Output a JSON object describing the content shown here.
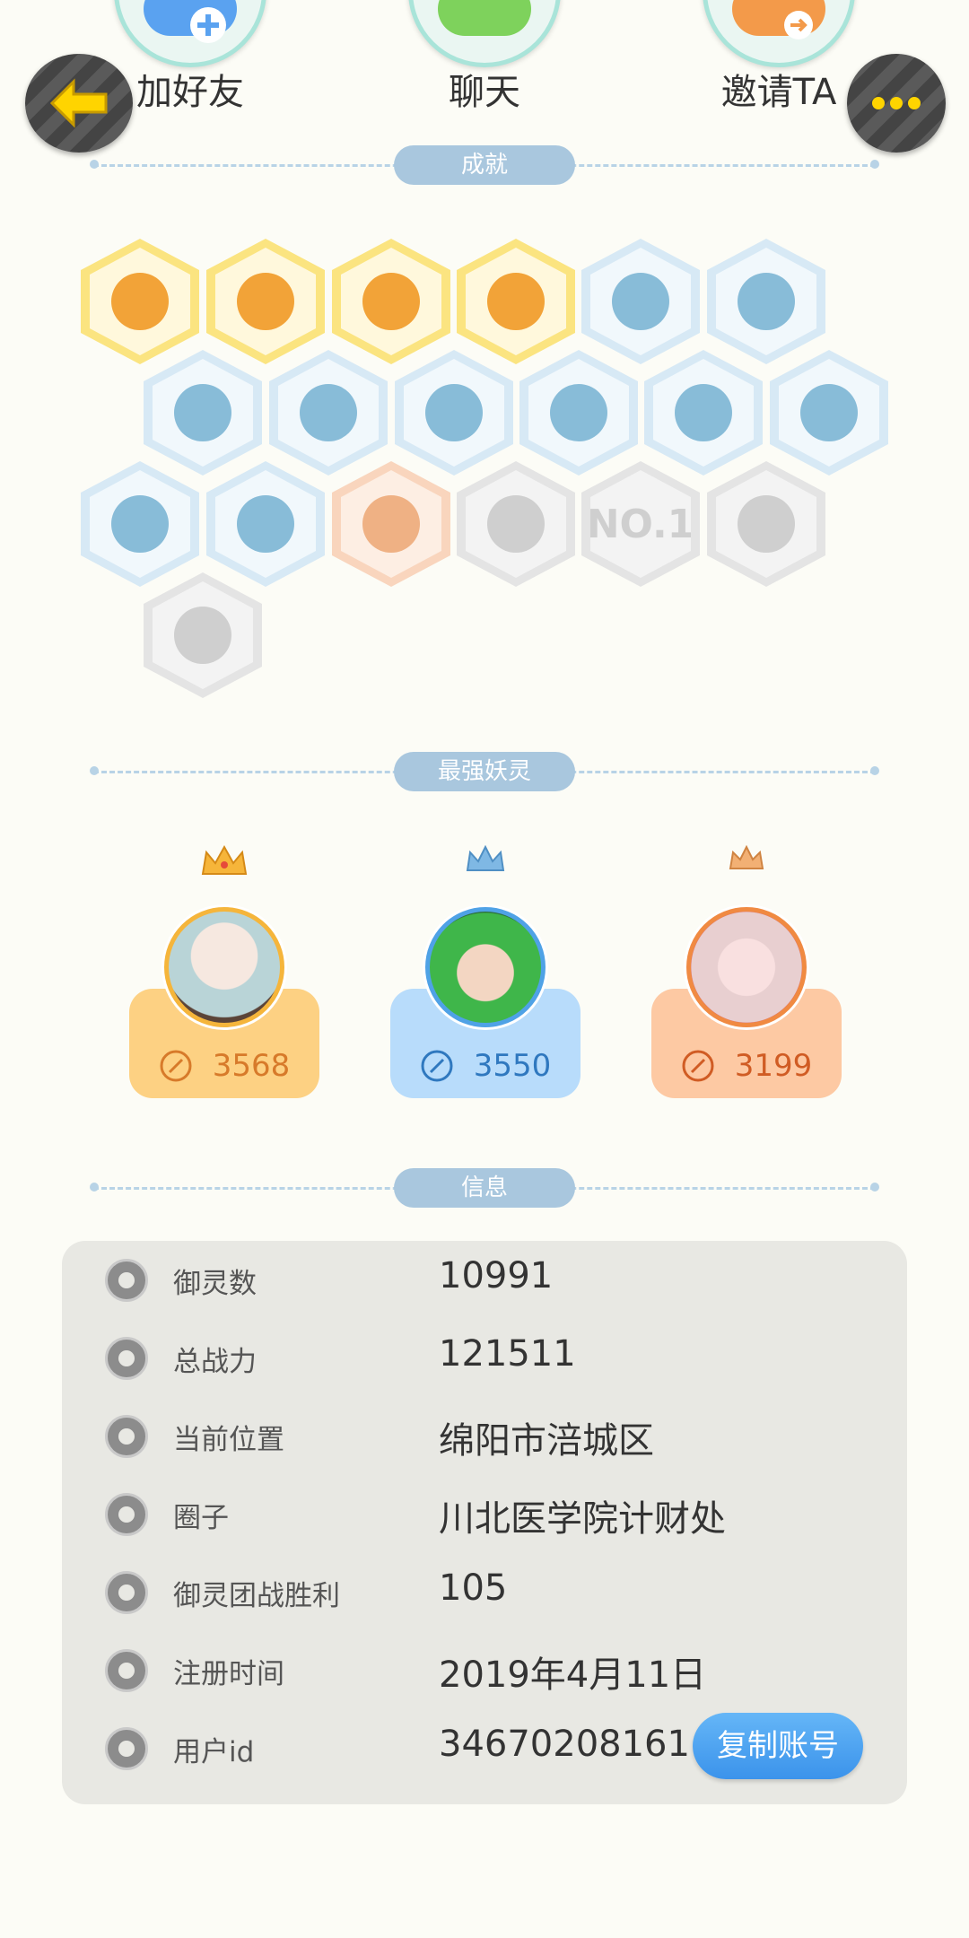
{
  "actions": {
    "add_friend": "加好友",
    "chat": "聊天",
    "invite": "邀请TA"
  },
  "sections": {
    "achievements": "成就",
    "strongest": "最强妖灵",
    "info": "信息"
  },
  "achievements": {
    "row1": [
      {
        "tier": "gold",
        "icon": "fox-face-badge"
      },
      {
        "tier": "gold",
        "icon": "moon-sun-badge"
      },
      {
        "tier": "gold",
        "icon": "orb-badge"
      },
      {
        "tier": "gold",
        "icon": "yinyang-box-badge"
      },
      {
        "tier": "blue",
        "icon": "sneaker-badge"
      },
      {
        "tier": "blue",
        "icon": "portal-badge"
      }
    ],
    "row2": [
      {
        "tier": "blue",
        "icon": "crystal-badge"
      },
      {
        "tier": "blue",
        "icon": "taiji-wave-badge"
      },
      {
        "tier": "blue",
        "icon": "sprite-statue-badge"
      },
      {
        "tier": "blue",
        "icon": "cat-cart-badge"
      },
      {
        "tier": "blue",
        "icon": "cat-lollipop-badge"
      },
      {
        "tier": "blue",
        "icon": "fish-badge"
      }
    ],
    "row3": [
      {
        "tier": "blue",
        "icon": "shield-badge"
      },
      {
        "tier": "blue",
        "icon": "horned-monster-badge"
      },
      {
        "tier": "peach",
        "icon": "sprite-pair-badge"
      },
      {
        "tier": "grey",
        "icon": "fox-book-badge"
      },
      {
        "tier": "grey",
        "icon": "no1-badge",
        "text": "NO.1"
      },
      {
        "tier": "grey",
        "icon": "skull-belt-badge"
      }
    ],
    "row4": [
      {
        "tier": "grey",
        "icon": "crossed-swords-badge"
      }
    ]
  },
  "spirits": [
    {
      "power": "3568",
      "crown": "gold-crown-icon"
    },
    {
      "power": "3550",
      "crown": "blue-crown-icon"
    },
    {
      "power": "3199",
      "crown": "bronze-crown-icon"
    }
  ],
  "info": {
    "rows": [
      {
        "key": "御灵数",
        "value": "10991",
        "icon": "spirit-count-icon"
      },
      {
        "key": "总战力",
        "value": "121511",
        "icon": "power-icon"
      },
      {
        "key": "当前位置",
        "value": "绵阳市涪城区",
        "icon": "location-pin-icon"
      },
      {
        "key": "圈子",
        "value": "川北医学院计财处",
        "icon": "circle-group-icon"
      },
      {
        "key": "御灵团战胜利",
        "value": "105",
        "icon": "team-battle-icon"
      },
      {
        "key": "注册时间",
        "value": "2019年4月11日",
        "icon": "clock-icon"
      },
      {
        "key": "用户id",
        "value": "34670208161",
        "icon": "id-card-icon"
      }
    ],
    "copy_button": "复制账号"
  },
  "colors": {
    "background": "#fcfcf6",
    "section_pill": "#a9c7de",
    "copy_button": "#4aa3f0",
    "back_arrow": "#ffd400"
  }
}
